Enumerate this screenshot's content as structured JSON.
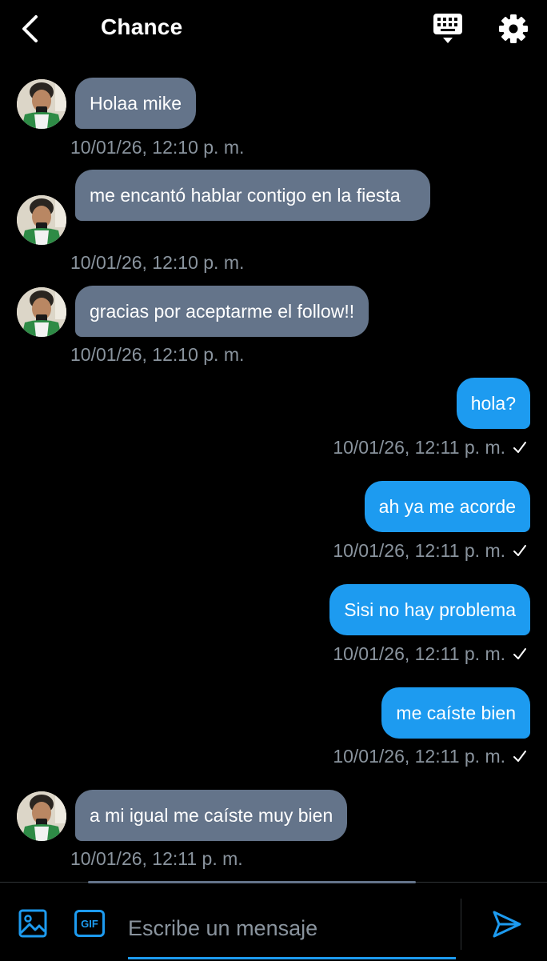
{
  "header": {
    "title": "Chance"
  },
  "messages": [
    {
      "side": "in",
      "text": "Holaa mike",
      "time": "10/01/26, 12:10 p. m."
    },
    {
      "side": "in",
      "text": "me encantó hablar contigo en la fiesta",
      "time": "10/01/26, 12:10 p. m."
    },
    {
      "side": "in",
      "text": "gracias por aceptarme el follow!!",
      "time": "10/01/26, 12:10 p. m."
    },
    {
      "side": "out",
      "text": "hola?",
      "time": "10/01/26, 12:11 p. m.",
      "status": "sent"
    },
    {
      "side": "out",
      "text": "ah ya me acorde",
      "time": "10/01/26, 12:11 p. m.",
      "status": "sent"
    },
    {
      "side": "out",
      "text": "Sisi no hay problema",
      "time": "10/01/26, 12:11 p. m.",
      "status": "sent"
    },
    {
      "side": "out",
      "text": "me caíste bien",
      "time": "10/01/26, 12:11 p. m.",
      "status": "sent"
    },
    {
      "side": "in",
      "text": "a mi igual me caíste muy bien",
      "time": "10/01/26, 12:11 p. m."
    }
  ],
  "composer": {
    "placeholder": "Escribe un mensaje",
    "gif_label": "GIF"
  },
  "icons": {
    "back": "chevron-left-icon",
    "keyboard": "keyboard-icon",
    "settings": "gear-icon",
    "image": "image-icon",
    "gif": "gif-icon",
    "send": "send-icon",
    "check": "check-icon"
  },
  "colors": {
    "background": "#000000",
    "incoming_bubble": "#64748a",
    "outgoing_bubble": "#1d9bf0",
    "timestamp": "#8a949e",
    "accent": "#1d9bf0"
  }
}
